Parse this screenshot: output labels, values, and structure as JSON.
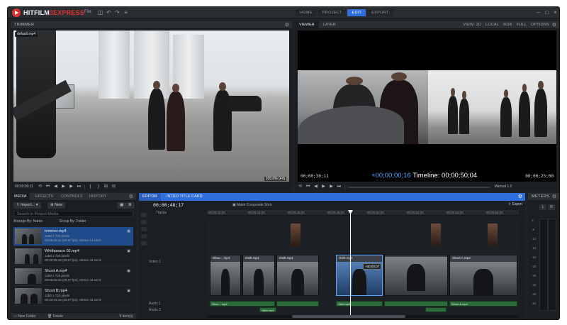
{
  "app": {
    "name_part1": "HITFILM",
    "name_part2": "3EXPRESS",
    "file_menu": "File"
  },
  "nav": {
    "tabs": [
      {
        "label": "HOME",
        "active": false
      },
      {
        "label": "PROJECT",
        "active": false
      },
      {
        "label": "EDIT",
        "active": true
      },
      {
        "label": "EXPORT",
        "active": false
      }
    ]
  },
  "trimmer": {
    "title": "TRIMMER",
    "filename": "default.mp4",
    "zoom": "100.0% (Fit)",
    "timecode": "00;00;00;11"
  },
  "viewer": {
    "tabs": [
      "VIEWER",
      "LAYER"
    ],
    "options": [
      "VIEW: 2D",
      "LOCAL",
      "RGB",
      "FULL",
      "OPTIONS"
    ],
    "tc_left": "00;00;30;11",
    "tc_offset": "+00;00;00;16",
    "tc_label": "Timeline:",
    "tc_value": "00;00;50;04",
    "tc_right": "00;00;25;00",
    "zoom": "Manual 1.0"
  },
  "media": {
    "tabs": [
      "MEDIA",
      "EFFECTS",
      "CONTROLS",
      "HISTORY"
    ],
    "import_label": "Import...",
    "new_label": "New",
    "search_placeholder": "Search in Project Media",
    "arrange_label": "Arrange By: Name",
    "group_label": "Group By: Folder",
    "items": [
      {
        "name": "trimmer.mp4",
        "desc": "1280 x 720 pixels\n00;00;06;11 (29.97 fps), Stereo 44.1kHz",
        "selected": true
      },
      {
        "name": "Whithpeace 02.mp4",
        "desc": "1280 x 720 pixels\n00;00;05;18 (29.97 fps), Stereo 44.1kHz",
        "selected": false
      },
      {
        "name": "Shoot A.mp4",
        "desc": "1280 x 720 pixels\n00;00;02;10 (29.97 fps), Stereo 44.1kHz",
        "selected": false
      },
      {
        "name": "Shoot B.mp4",
        "desc": "1280 x 720 pixels\n00;00;03;18 (29.97 fps), Stereo 44.1kHz",
        "selected": false
      }
    ],
    "footer_new_folder": "New Folder",
    "footer_delete": "Delete",
    "footer_count": "9 item(s)"
  },
  "editor": {
    "tabs": [
      "EDITOR",
      "INTRO TITLE CARD"
    ],
    "timecode": "00;00;48;17",
    "snap_label": "Make Composite Shot",
    "export_label": "Export",
    "tracks_label": "Tracks",
    "ruler": [
      "00;00;42;00",
      "00;00;44;00",
      "00;00;46;00",
      "00;00;48;00",
      "00;00;50;00",
      "00;00;52;00",
      "00;00;54;00",
      "00;00;56;00"
    ],
    "track_video": "Video 1",
    "track_audio1": "Audio 1",
    "track_audio2": "Audio 2",
    "clips": [
      "Shoo... mp4",
      "Gtirlt.mp4",
      "Gtirlt.mp4",
      "Gtirlt.mp4",
      "Shoot A.mp4"
    ],
    "audio_clips": [
      "Shoo... mp4",
      "Gtirlt.mp4",
      "Gtirlt.mp4",
      "Shoot A.mp4"
    ],
    "tooltip": "+00;00;07"
  },
  "meters": {
    "title": "METERS",
    "labels": [
      "0",
      "-6",
      "-12",
      "-18",
      "-24",
      "-30",
      "-36",
      "-42",
      "-48",
      "-54"
    ]
  },
  "colors": {
    "accent": "#2f6fdc",
    "brand_red": "#e0322d",
    "timecode_blue": "#5ea2ff"
  }
}
